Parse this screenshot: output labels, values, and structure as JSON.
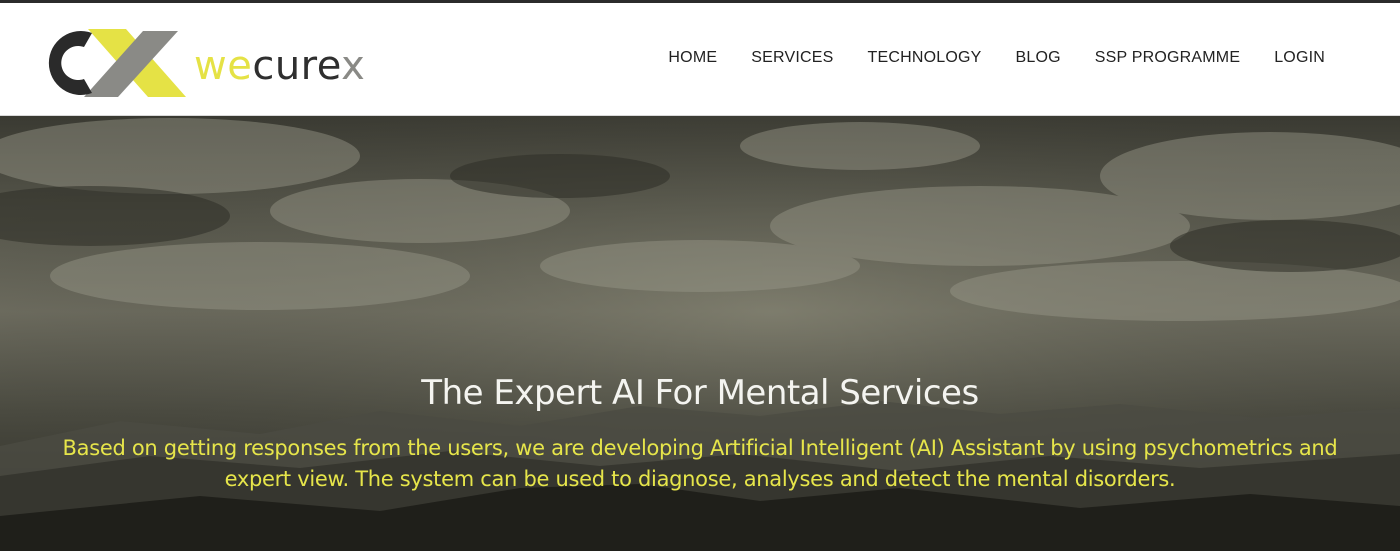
{
  "brand": {
    "name_we": "we",
    "name_cure": "cure",
    "name_x": "x",
    "colors": {
      "yellow": "#e5e245",
      "dark": "#2f2f2f",
      "grey": "#8a8a86"
    }
  },
  "nav": {
    "items": [
      {
        "label": "HOME"
      },
      {
        "label": "SERVICES"
      },
      {
        "label": "TECHNOLOGY"
      },
      {
        "label": "BLOG"
      },
      {
        "label": "SSP PROGRAMME"
      },
      {
        "label": "LOGIN"
      }
    ]
  },
  "hero": {
    "title": "The Expert AI For Mental Services",
    "text": "Based on getting responses from the users, we are developing Artificial Intelligent (AI) Assistant by using psychometrics and expert view. The system can be used to diagnose, analyses and detect the mental disorders.",
    "text_color": "#e6e54a"
  }
}
